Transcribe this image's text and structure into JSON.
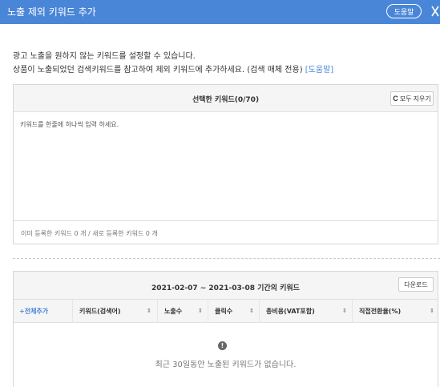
{
  "header": {
    "title": "노출 제외 키워드 추가",
    "help_label": "도움말",
    "bg_color": "#4a86d8"
  },
  "description": {
    "line1": "광고 노출을 원하지 않는 키워드를 설정할 수 있습니다.",
    "line2": "상품이 노출되었던 검색키워드를 참고하여 제외 키워드에 추가하세요. (검색 매체 전용)",
    "help_link": "[도움말]"
  },
  "selected_panel": {
    "title": "선택한 키워드(0/70)",
    "clear_label": "모두 지우기",
    "placeholder": "키워드를 한줄에 하나씩 입력 하세요.",
    "count_text": "이미 등록한 키워드 0 개 / 새로 등록한 키워드 0 개"
  },
  "keyword_panel": {
    "title": "2021-02-07 ~ 2021-03-08 기간의 키워드",
    "download_label": "다운로드",
    "columns": [
      {
        "label": "+전체추가",
        "sortable": false
      },
      {
        "label": "키워드(검색어)",
        "sortable": true
      },
      {
        "label": "노출수",
        "sortable": true
      },
      {
        "label": "클릭수",
        "sortable": true
      },
      {
        "label": "총비용(VAT포함)",
        "sortable": true
      },
      {
        "label": "직접전환율(%)",
        "sortable": true
      }
    ],
    "empty_icon_glyph": "!",
    "empty_text": "최근 30일동안 노출된 키워드가 없습니다."
  },
  "icons": {
    "close": "close-icon",
    "clear": "refresh-icon",
    "sort": "sort-icon",
    "empty": "exclamation-icon"
  },
  "sort_glyph": "⇕"
}
